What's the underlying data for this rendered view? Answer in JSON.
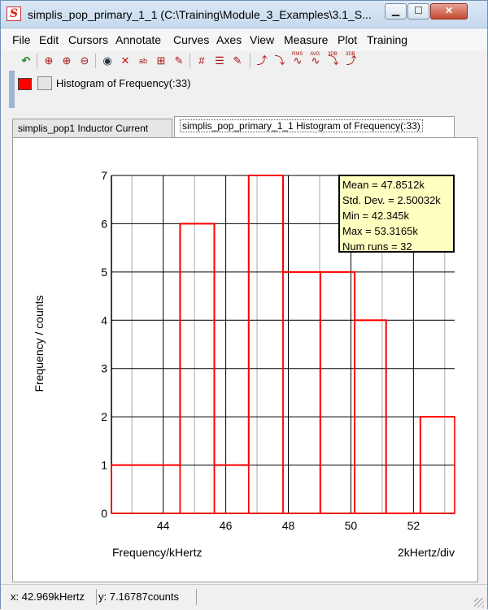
{
  "window": {
    "title": "simplis_pop_primary_1_1 (C:\\Training\\Module_3_Examples\\3.1_S...",
    "app_icon": "S",
    "controls": {
      "minimize": "minimize-icon",
      "maximize": "maximize-icon",
      "close": "close-icon"
    }
  },
  "menu": [
    "File",
    "Edit",
    "Cursors",
    "Annotate",
    "Curves",
    "Axes",
    "View",
    "Measure",
    "Plot",
    "Training"
  ],
  "toolbar": {
    "icons": [
      {
        "name": "undo-icon",
        "glyph": "↶",
        "color": "#2b8a2b"
      },
      {
        "name": "zoom-box-icon",
        "glyph": "🔍",
        "color": "#a11"
      },
      {
        "name": "zoom-in-icon",
        "glyph": "🔍",
        "color": "#a11"
      },
      {
        "name": "zoom-out-icon",
        "glyph": "🔍",
        "color": "#a11"
      },
      {
        "name": "eye-icon",
        "glyph": "👁",
        "color": "#234"
      },
      {
        "name": "delete-curve-icon",
        "glyph": "✕",
        "color": "#c11"
      },
      {
        "name": "label-curve-icon",
        "glyph": "ab",
        "color": "#a11"
      },
      {
        "name": "add-axis-icon",
        "glyph": "⊞",
        "color": "#a11"
      },
      {
        "name": "edit-axis-icon",
        "glyph": "✎",
        "color": "#a11"
      },
      {
        "name": "grid-icon",
        "glyph": "#",
        "color": "#a11"
      },
      {
        "name": "stack-axis-icon",
        "glyph": "☰",
        "color": "#a11"
      },
      {
        "name": "axis-props-icon",
        "glyph": "✎",
        "color": "#a11"
      },
      {
        "name": "rise-time-icon",
        "glyph": "⤴",
        "color": "#a11"
      },
      {
        "name": "fall-time-icon",
        "glyph": "⤵",
        "color": "#a11"
      },
      {
        "name": "rms-icon",
        "glyph": "∿",
        "color": "#a11"
      },
      {
        "name": "average-icon",
        "glyph": "∿",
        "color": "#a11"
      },
      {
        "name": "3db-low-icon",
        "glyph": "⤵",
        "color": "#a11"
      },
      {
        "name": "3db-high-icon",
        "glyph": "⤴",
        "color": "#a11"
      }
    ],
    "icon_captions": {
      "rms": "RMS",
      "avg": "AVG",
      "db1": "3DB",
      "db2": "3DB"
    }
  },
  "legend": {
    "curve_label": "Histogram of Frequency(:33)",
    "curve_color": "#ff0000"
  },
  "tabs": [
    {
      "label": "simplis_pop1 Inductor Current",
      "active": false
    },
    {
      "label": "simplis_pop_primary_1_1 Histogram of Frequency(:33)",
      "active": true
    }
  ],
  "chart_data": {
    "type": "histogram",
    "title": "",
    "xlabel": "Frequency/kHertz",
    "ylabel": "Frequency / counts",
    "x_scale_label": "2kHertz/div",
    "xlim": [
      42.345,
      53.3165
    ],
    "ylim": [
      0,
      7
    ],
    "xticks": [
      44,
      46,
      48,
      50,
      52
    ],
    "yticks": [
      0,
      1,
      2,
      3,
      4,
      5,
      6,
      7
    ],
    "grid": true,
    "bin_edges": [
      42.345,
      44.539,
      45.634,
      46.733,
      47.83,
      49.025,
      50.12,
      51.125,
      52.22,
      53.3165
    ],
    "counts": [
      1,
      6,
      1,
      7,
      5,
      5,
      4,
      0,
      2
    ],
    "series": [
      {
        "name": "Histogram of Frequency(:33)",
        "color": "#ff0000"
      }
    ],
    "stats": [
      "Mean = 47.8512k",
      "Std. Dev. = 2.50032k",
      "Min = 42.345k",
      "Max = 53.3165k",
      "Num runs = 32"
    ]
  },
  "status": {
    "x": "x: 42.969kHertz",
    "y": "y: 7.16787counts"
  }
}
